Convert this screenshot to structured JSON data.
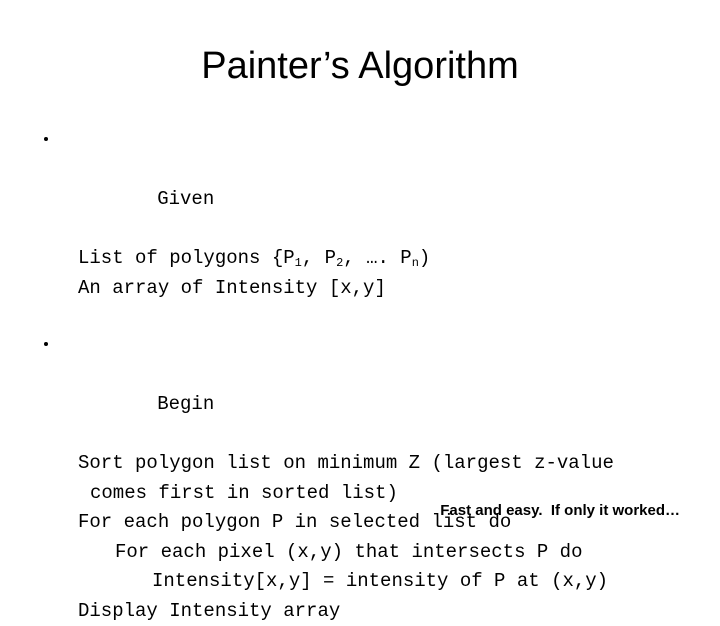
{
  "slide": {
    "title": "Painter’s Algorithm",
    "background_color": "#ffffff",
    "text_color": "#000000",
    "blocks": [
      {
        "bullet_label": "Given",
        "lines": [
          {
            "indent": 0,
            "text_prefix": "List of polygons {P",
            "sub1": "1",
            "mid1": ", P",
            "sub2": "2",
            "mid2": ", …. P",
            "sub3": "n",
            "suffix": ")"
          },
          {
            "indent": 0,
            "text": "An array of Intensity [x,y]"
          }
        ]
      },
      {
        "bullet_label": "Begin",
        "lines": [
          {
            "indent": 0,
            "text": "Sort polygon list on minimum Z (largest z-value"
          },
          {
            "indent": 1,
            "text": "comes first in sorted list)"
          },
          {
            "indent": 0,
            "text": "For each polygon P in selected list do"
          },
          {
            "indent": 2,
            "text": "For each pixel (x,y) that intersects P do"
          },
          {
            "indent": 3,
            "text": "Intensity[x,y] = intensity of P at (x,y)"
          },
          {
            "indent": 0,
            "text": "Display Intensity array"
          }
        ]
      }
    ],
    "footer": "Fast and easy.  If only it worked…"
  }
}
